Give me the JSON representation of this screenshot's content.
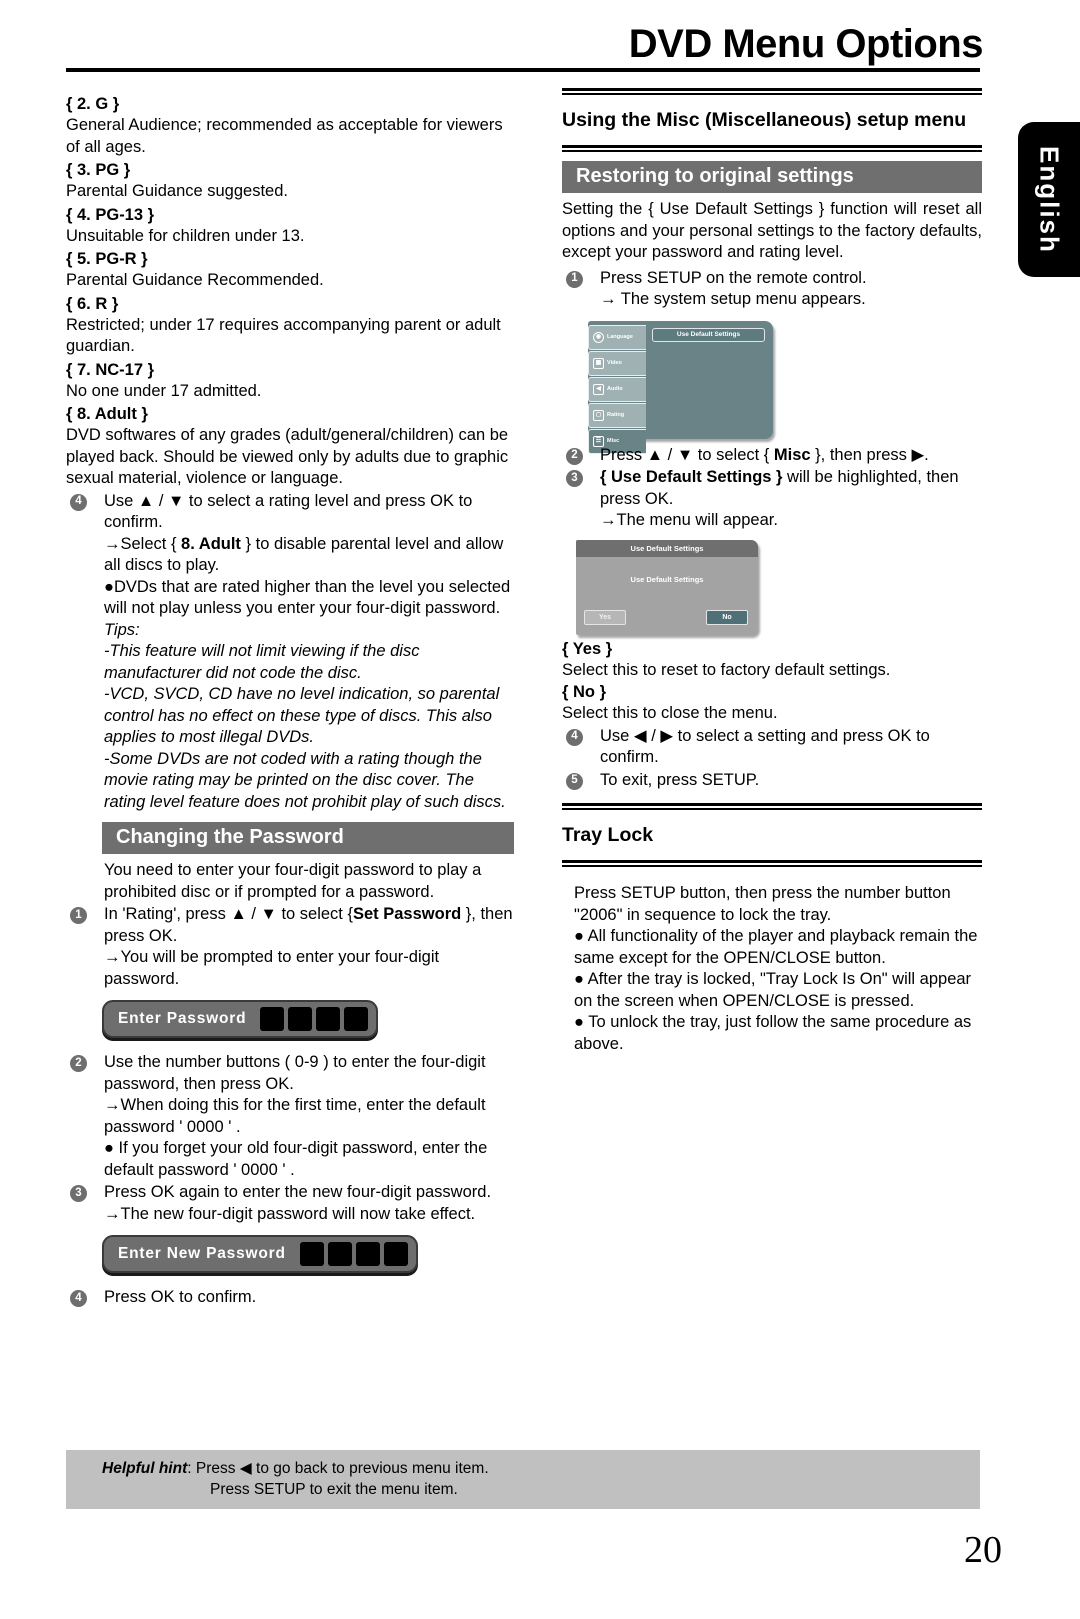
{
  "header": {
    "title": "DVD Menu Options",
    "language_tab": "English"
  },
  "left_column": {
    "ratings": [
      {
        "label": "{ 2. G }",
        "desc": "General Audience; recommended as acceptable for viewers of all ages."
      },
      {
        "label": "{ 3. PG }",
        "desc": "Parental Guidance suggested."
      },
      {
        "label": "{ 4. PG-13 }",
        "desc": "Unsuitable for children under 13."
      },
      {
        "label": "{ 5. PG-R }",
        "desc": "Parental Guidance Recommended."
      },
      {
        "label": "{ 6. R }",
        "desc": "Restricted; under 17 requires accompanying parent or adult guardian."
      },
      {
        "label": "{ 7. NC-17 }",
        "desc": "No one under 17 admitted."
      },
      {
        "label": "{ 8. Adult }",
        "desc": "DVD softwares of any grades (adult/general/children) can be played back. Should be viewed only by adults due to graphic sexual material, violence or language."
      }
    ],
    "step4": {
      "num": "4",
      "text": "Use ▲ / ▼ to select a rating level and press OK to confirm.",
      "arrow_pre": "→Select { ",
      "arrow_bold": "8. Adult",
      "arrow_post": " } to disable parental level and allow all discs to play.",
      "bullet": "●DVDs that are rated higher than the level you selected will not play unless you enter your four-digit password."
    },
    "tips": {
      "heading": "Tips:",
      "items": [
        "-This feature will not limit viewing if the disc manufacturer did not code the disc.",
        "-VCD, SVCD, CD have no level indication, so parental control has no effect on these type of discs. This also applies to most illegal DVDs.",
        "-Some DVDs are not coded with a rating though the movie rating may be printed on the disc cover. The rating level feature does not prohibit play of such discs."
      ]
    },
    "password_section": {
      "bar_title": "Changing the Password",
      "intro": "You need to enter your four-digit password to play a prohibited disc or if prompted for a password.",
      "step1": {
        "num": "1",
        "pre": "In 'Rating', press ▲ / ▼ to select {",
        "bold": "Set Password",
        "post": " }, then press OK.",
        "arrow": "→You will be prompted to enter your four-digit password."
      },
      "enter_password_graphic": {
        "label": "Enter Password",
        "cells": 4
      },
      "step2": {
        "num": "2",
        "text": "Use the number buttons ( 0-9 ) to enter the four-digit password, then press OK.",
        "arrow": "→When doing this for the first time, enter the default password ʹ 0000 ʹ .",
        "bullet": "● If you forget your old four-digit password, enter the default  password ʹ  0000 ʹ ."
      },
      "step3": {
        "num": "3",
        "text": "Press OK again to enter the new four-digit password.",
        "arrow": "→The new four-digit password will now take effect."
      },
      "enter_new_password_graphic": {
        "label": "Enter New Password",
        "cells": 4
      },
      "step4": {
        "num": "4",
        "text": "Press OK to confirm."
      }
    }
  },
  "right_column": {
    "section_heading": "Using the Misc (Miscellaneous) setup menu",
    "restore": {
      "bar_title": "Restoring to original settings",
      "intro": "Setting the { Use Default Settings } function will reset all options and your personal settings to the factory defaults, except your password and rating level.",
      "step1": {
        "num": "1",
        "text": "Press SETUP on the remote control.",
        "arrow": "→ The system setup menu appears."
      },
      "setup_menu_screenshot": {
        "tabs": [
          {
            "label": "Language",
            "icon": "globe-icon"
          },
          {
            "label": "Video",
            "icon": "film-icon"
          },
          {
            "label": "Audio",
            "icon": "speaker-icon"
          },
          {
            "label": "Rating",
            "icon": "lock-icon"
          },
          {
            "label": "Misc",
            "icon": "document-icon"
          }
        ],
        "active_tab": "Misc",
        "highlighted_item": "Use Default Settings"
      },
      "step2": {
        "num": "2",
        "pre": "Press ▲ / ▼ to select { ",
        "bold": "Misc",
        "post": " }, then press ▶."
      },
      "step3": {
        "num": "3",
        "bold": "{ Use Default Settings }",
        "post": " will be highlighted, then press OK.",
        "arrow": "→The menu will appear."
      },
      "dialog_screenshot": {
        "title": "Use Default Settings",
        "message": "Use Default Settings",
        "yes_label": "Yes",
        "no_label": "No",
        "selected": "No"
      },
      "yes_head": "{ Yes }",
      "yes_desc": "Select this to reset to factory default settings.",
      "no_head": "{ No }",
      "no_desc": "Select this to close the menu.",
      "step4": {
        "num": "4",
        "text": "Use ◀ / ▶ to select a setting and press OK to confirm."
      },
      "step5": {
        "num": "5",
        "text": "To exit, press SETUP."
      }
    },
    "tray_lock": {
      "heading": "Tray Lock",
      "intro": "Press SETUP button, then press the number button \"2006\" in sequence to lock the tray.",
      "bullets": [
        "● All functionality of the player and playback remain the same except for the OPEN/CLOSE button.",
        "● After the tray is locked, \"Tray Lock Is On\" will appear on the screen when OPEN/CLOSE is pressed.",
        "● To unlock the tray, just follow the same procedure as above."
      ]
    }
  },
  "footer": {
    "hint_label": "Helpful hint",
    "hint_line1": ":  Press ◀ to go back to previous menu item.",
    "hint_line2": "Press SETUP to exit the menu item.",
    "page_number": "20"
  },
  "colors": {
    "section_bar": "#6f6f6f",
    "hint_bg": "#c0c0c0",
    "menu_teal": "#6a8387",
    "dialog_gray": "#a3a3a3",
    "selected_button": "#4f7076"
  }
}
